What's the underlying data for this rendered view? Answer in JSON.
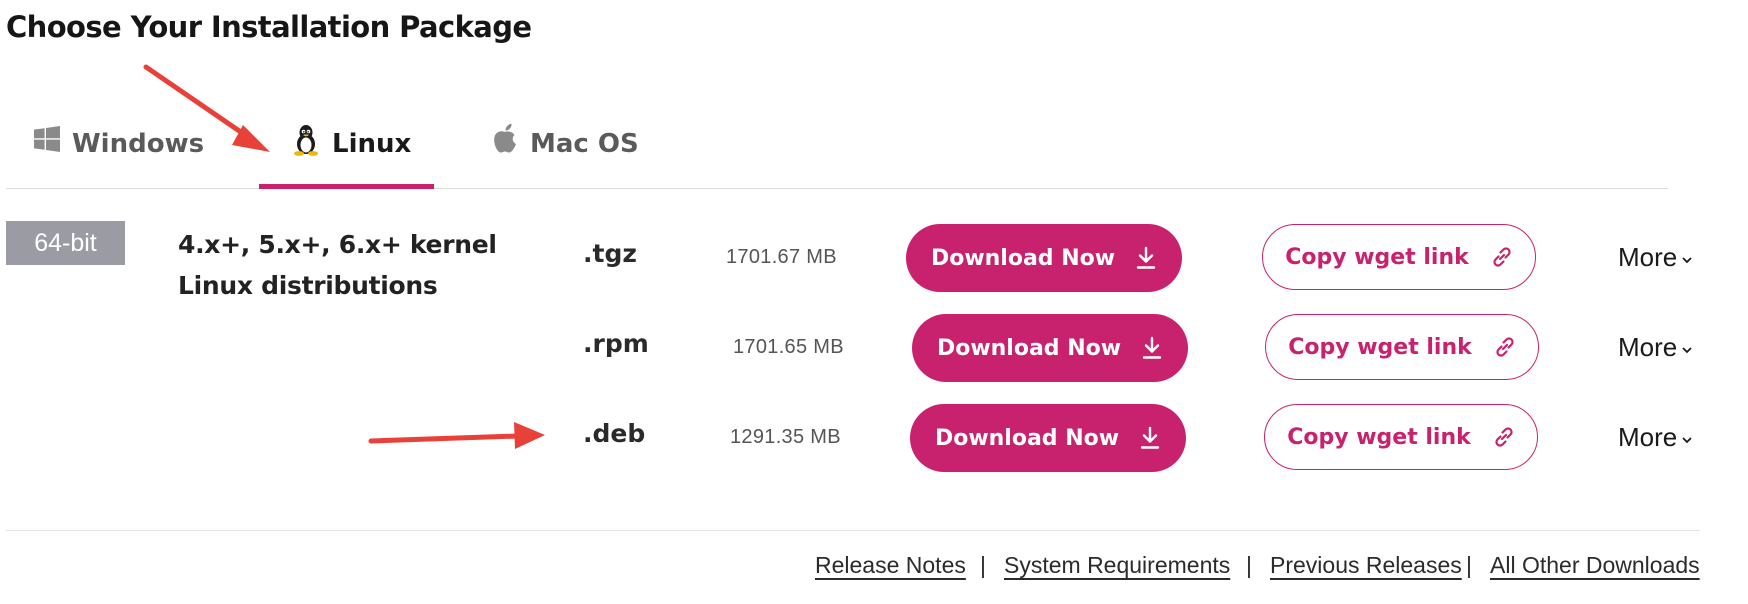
{
  "page_title": "Choose Your Installation Package",
  "tabs": [
    {
      "label": "Windows",
      "icon": "windows-icon",
      "active": false
    },
    {
      "label": "Linux",
      "icon": "linux-icon",
      "active": true
    },
    {
      "label": "Mac OS",
      "icon": "apple-icon",
      "active": false
    }
  ],
  "package": {
    "bits": "64-bit",
    "description": "4.x+, 5.x+, 6.x+ kernel Linux distributions",
    "rows": [
      {
        "ext": ".tgz",
        "size": "1701.67 MB",
        "download_label": "Download Now",
        "wget_label": "Copy wget link",
        "more_label": "More"
      },
      {
        "ext": ".rpm",
        "size": "1701.65 MB",
        "download_label": "Download Now",
        "wget_label": "Copy wget link",
        "more_label": "More"
      },
      {
        "ext": ".deb",
        "size": "1291.35 MB",
        "download_label": "Download Now",
        "wget_label": "Copy wget link",
        "more_label": "More"
      }
    ]
  },
  "footer": {
    "links": [
      "Release Notes",
      "System Requirements",
      "Previous Releases",
      "All Other Downloads"
    ],
    "separator": "|"
  },
  "colors": {
    "accent": "#c8226e",
    "badge": "#9b9ca3",
    "annotation_arrow": "#e8413a"
  },
  "icons": [
    "windows-icon",
    "linux-icon",
    "apple-icon",
    "download-icon",
    "link-icon",
    "chevron-down-icon"
  ]
}
